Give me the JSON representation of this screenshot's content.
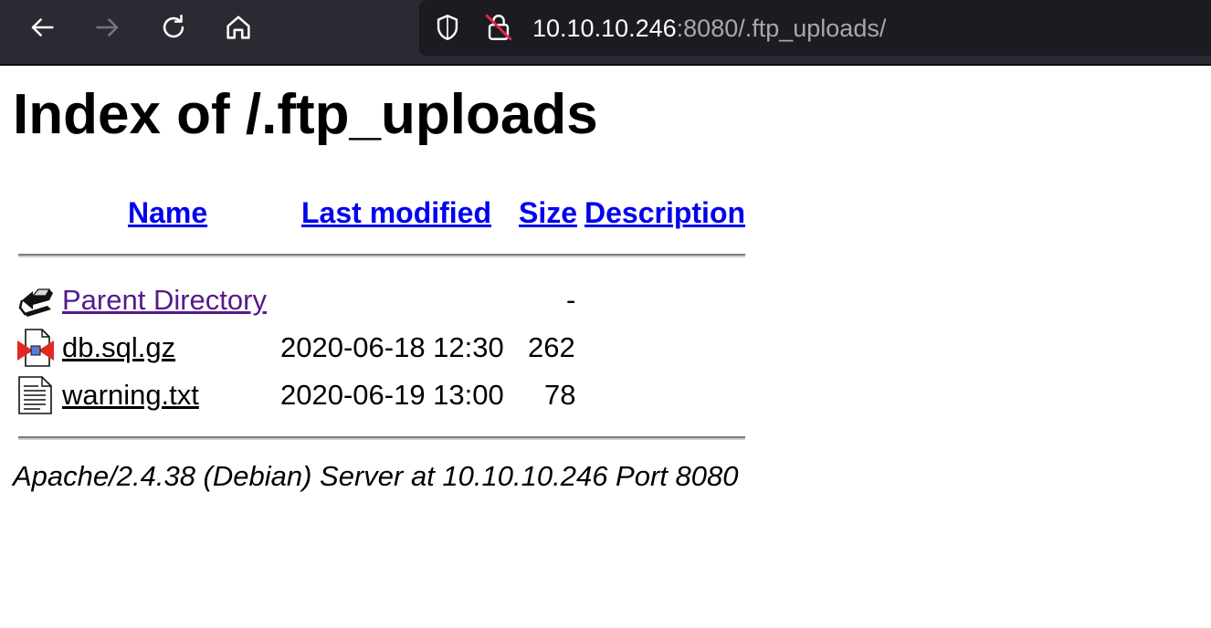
{
  "browser": {
    "url": {
      "host": "10.10.10.246",
      "rest": ":8080/.ftp_uploads/"
    },
    "icons": {
      "back": "back-arrow-icon",
      "forward": "forward-arrow-icon",
      "reload": "reload-icon",
      "home": "home-icon",
      "tracking": "shield-icon",
      "insecure": "insecure-lock-icon"
    }
  },
  "page": {
    "title": "Index of /.ftp_uploads",
    "columns": {
      "name": "Name",
      "last_modified": "Last modified",
      "size": "Size",
      "description": "Description"
    },
    "rows": [
      {
        "icon": "back-folder-icon",
        "name": "Parent Directory",
        "last_modified": "",
        "size": "-",
        "description": ""
      },
      {
        "icon": "compressed-file-icon",
        "name": "db.sql.gz",
        "last_modified": "2020-06-18 12:30",
        "size": "262",
        "description": ""
      },
      {
        "icon": "text-file-icon",
        "name": "warning.txt",
        "last_modified": "2020-06-19 13:00",
        "size": "78",
        "description": ""
      }
    ],
    "footer": "Apache/2.4.38 (Debian) Server at 10.10.10.246 Port 8080"
  },
  "colors": {
    "toolbar_bg": "#2b2a33",
    "urlbar_bg": "#1c1b22",
    "link": "#0000ee",
    "visited_link": "#551a8b"
  }
}
